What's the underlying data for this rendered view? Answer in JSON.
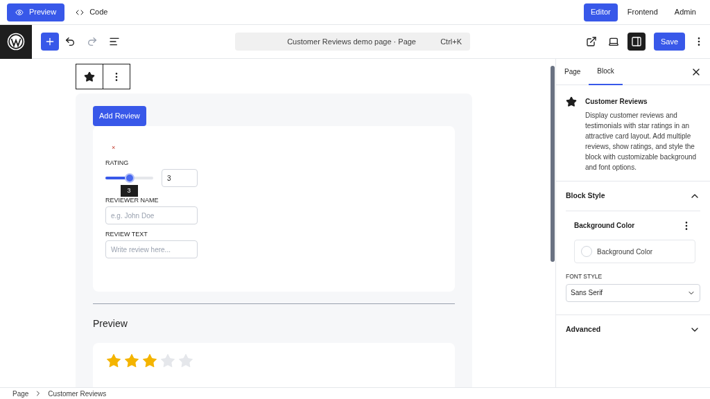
{
  "view_modes": [
    {
      "label": "Preview",
      "selected": true
    },
    {
      "label": "Code",
      "selected": false
    }
  ],
  "app_modes": [
    {
      "label": "Editor",
      "selected": true
    },
    {
      "label": "Frontend",
      "selected": false
    },
    {
      "label": "Admin",
      "selected": false
    }
  ],
  "toolbar": {
    "command_bar": {
      "title": "Customer Reviews demo page · Page",
      "shortcut": "Ctrl+K"
    },
    "save": "Save",
    "sidebar_toggle_on": true
  },
  "editor": {
    "add_button": "Add Review",
    "remove_mark": "×",
    "rating": {
      "label": "RATING",
      "level": 0.5,
      "value": "3",
      "tooltip": "3"
    },
    "reviewer_name": {
      "label": "REVIEWER NAME",
      "placeholder": "e.g. John Doe"
    },
    "review_text": {
      "label": "REVIEW TEXT",
      "placeholder": "Write review here..."
    },
    "preview_heading": "Preview",
    "preview_card": {
      "stars": 3
    }
  },
  "sidebar": {
    "tabs": [
      {
        "label": "Page",
        "selected": false
      },
      {
        "label": "Block",
        "selected": true
      }
    ],
    "block": {
      "title": "Customer Reviews",
      "description": "Display customer reviews and testimonials with star ratings in an attractive card layout. Add multiple reviews, show ratings, and style the block with customizable background and font options."
    },
    "panels": [
      {
        "title": "Block Style",
        "expanded": true
      },
      {
        "title": "Advanced",
        "expanded": false
      }
    ],
    "block_style": {
      "color_heading": "Background Color",
      "color_button": "Background Color",
      "font_label": "FONT STYLE",
      "font_value": "Sans Serif"
    }
  },
  "breadcrumb": [
    "Page",
    "Customer Reviews"
  ]
}
